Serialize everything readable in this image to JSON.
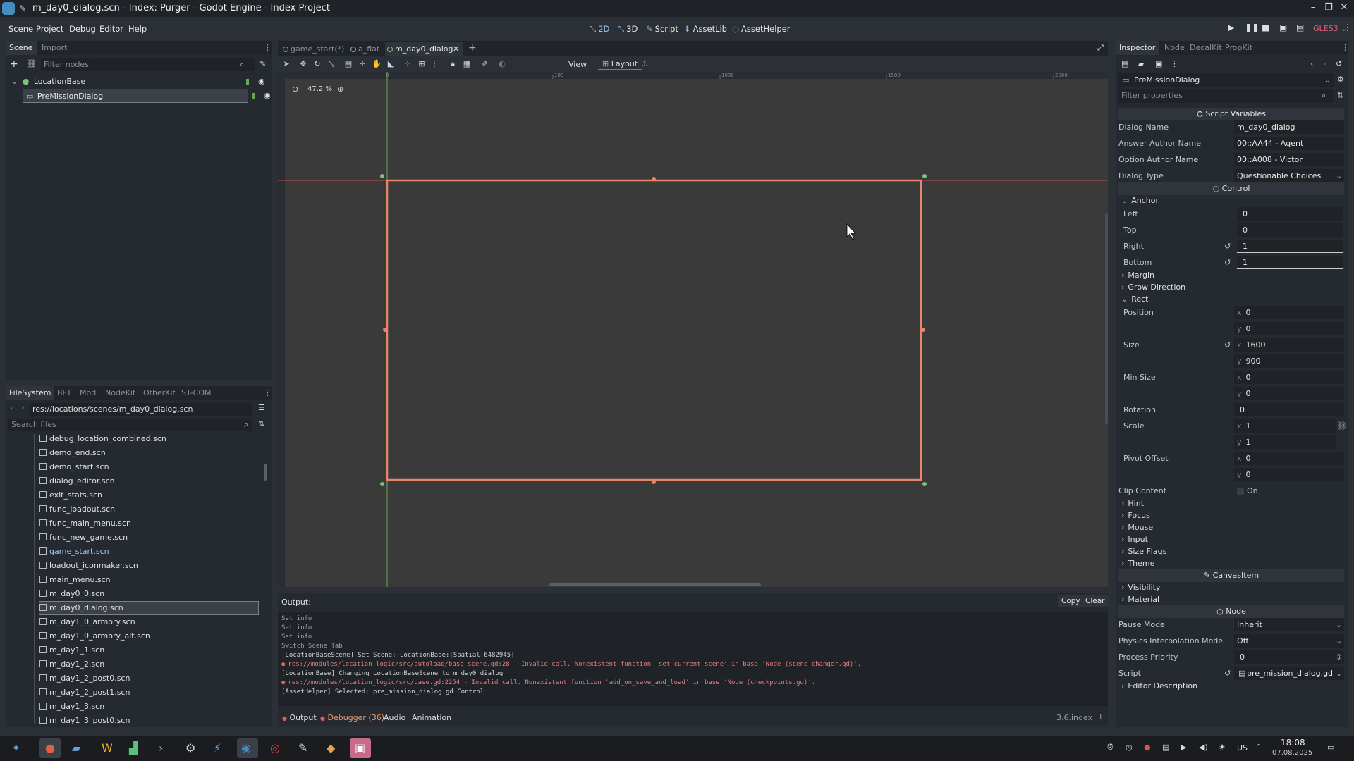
{
  "window": {
    "title": "m_day0_dialog.scn - Index: Purger - Godot Engine - Index Project"
  },
  "menu": [
    "Scene",
    "Project",
    "Debug",
    "Editor",
    "Help"
  ],
  "workspaces": [
    "2D",
    "3D",
    "Script",
    "AssetLib",
    "AssetHelper"
  ],
  "renderer": "GLES3",
  "scene_dock": {
    "tabs": [
      "Scene",
      "Import"
    ],
    "filter_placeholder": "Filter nodes",
    "nodes": [
      "LocationBase",
      "PreMissionDialog"
    ]
  },
  "fs_dock": {
    "tabs": [
      "FileSystem",
      "BFT",
      "Mod",
      "NodeKit",
      "OtherKit",
      "ST-COM"
    ],
    "path": "res://locations/scenes/m_day0_dialog.scn",
    "search_placeholder": "Search files",
    "files": [
      "debug_location_combined.scn",
      "demo_end.scn",
      "demo_start.scn",
      "dialog_editor.scn",
      "exit_stats.scn",
      "func_loadout.scn",
      "func_main_menu.scn",
      "func_new_game.scn",
      "game_start.scn",
      "loadout_iconmaker.scn",
      "main_menu.scn",
      "m_day0_0.scn",
      "m_day0_dialog.scn",
      "m_day1_0_armory.scn",
      "m_day1_0_armory_alt.scn",
      "m_day1_1.scn",
      "m_day1_2.scn",
      "m_day1_2_post0.scn",
      "m_day1_2_post1.scn",
      "m_day1_3.scn",
      "m_day1_3_post0.scn"
    ],
    "selected_file": "m_day0_dialog.scn"
  },
  "scene_tabs": [
    "game_start(*)",
    "a_flat",
    "m_day0_dialog"
  ],
  "viewport": {
    "zoom": "47.2 %",
    "toolbar": {
      "view": "View",
      "layout": "Layout"
    },
    "ruler": [
      "0",
      "100",
      "1000",
      "1500",
      "2000"
    ]
  },
  "inspector": {
    "tabs": [
      "Inspector",
      "Node",
      "DecalKit",
      "PropKit"
    ],
    "object": "PreMissionDialog",
    "filter_placeholder": "Filter properties",
    "script_vars_header": "Script Variables",
    "script_vars": [
      {
        "label": "Dialog Name",
        "value": "m_day0_dialog"
      },
      {
        "label": "Answer Author Name",
        "value": "00::AA44 - Agent"
      },
      {
        "label": "Option Author Name",
        "value": "00::A008 - Victor"
      },
      {
        "label": "Dialog Type",
        "value": "Questionable Choices"
      }
    ],
    "control_header": "Control",
    "anchor_group": "Anchor",
    "anchors": [
      {
        "label": "Left",
        "value": "0"
      },
      {
        "label": "Top",
        "value": "0"
      },
      {
        "label": "Right",
        "value": "1"
      },
      {
        "label": "Bottom",
        "value": "1"
      }
    ],
    "groups_a": [
      "Margin",
      "Grow Direction"
    ],
    "rect_group": "Rect",
    "rect": {
      "position_label": "Position",
      "position": [
        "0",
        "0"
      ],
      "size_label": "Size",
      "size": [
        "1600",
        "900"
      ],
      "min_size_label": "Min Size",
      "min_size": [
        "0",
        "0"
      ],
      "rotation_label": "Rotation",
      "rotation": "0",
      "scale_label": "Scale",
      "scale": [
        "1",
        "1"
      ],
      "pivot_label": "Pivot Offset",
      "pivot": [
        "0",
        "0"
      ],
      "clip_label": "Clip Content",
      "clip": "On"
    },
    "groups_b": [
      "Hint",
      "Focus",
      "Mouse",
      "Input",
      "Size Flags",
      "Theme"
    ],
    "canvasitem_header": "CanvasItem",
    "groups_c": [
      "Visibility",
      "Material"
    ],
    "node_header": "Node",
    "node_props": [
      {
        "label": "Pause Mode",
        "value": "Inherit"
      },
      {
        "label": "Physics Interpolation Mode",
        "value": "Off"
      },
      {
        "label": "Process Priority",
        "value": "0"
      },
      {
        "label": "Script",
        "value": "pre_mission_dialog.gd"
      }
    ],
    "editor_description": "Editor Description"
  },
  "output": {
    "title": "Output:",
    "copy": "Copy",
    "clear": "Clear",
    "lines": [
      {
        "t": "Set info",
        "k": "dim"
      },
      {
        "t": "Set info",
        "k": "dim"
      },
      {
        "t": "Set info",
        "k": "dim"
      },
      {
        "t": "Switch Scene Tab",
        "k": "dim"
      },
      {
        "t": "[LocationBaseScene] Set Scene: LocationBase:[Spatial:6482945]",
        "k": ""
      },
      {
        "t": "res://modules/location_logic/src/autoload/base_scene.gd:28 - Invalid call. Nonexistent function 'set_current_scene' in base 'Node (scene_changer.gd)'.",
        "k": "err"
      },
      {
        "t": "[LocationBase] Changing LocationBaseScene to m_day0_dialog",
        "k": ""
      },
      {
        "t": "res://modules/location_logic/src/base.gd:2254 - Invalid call. Nonexistent function 'add_on_save_and_load' in base 'Node (checkpoints.gd)'.",
        "k": "err"
      },
      {
        "t": "[AssetHelper] Selected: pre_mission_dialog.gd Control",
        "k": ""
      }
    ],
    "bottom_tabs": [
      "Output",
      "Debugger (36)",
      "Audio",
      "Animation"
    ],
    "version": "3.6.index"
  },
  "taskbar": {
    "keyboard": "US",
    "time": "18:08",
    "date": "07.08.2025"
  },
  "colors": {
    "selection": "#e8856a",
    "accent": "#478cbf",
    "error": "#e87c7c"
  }
}
